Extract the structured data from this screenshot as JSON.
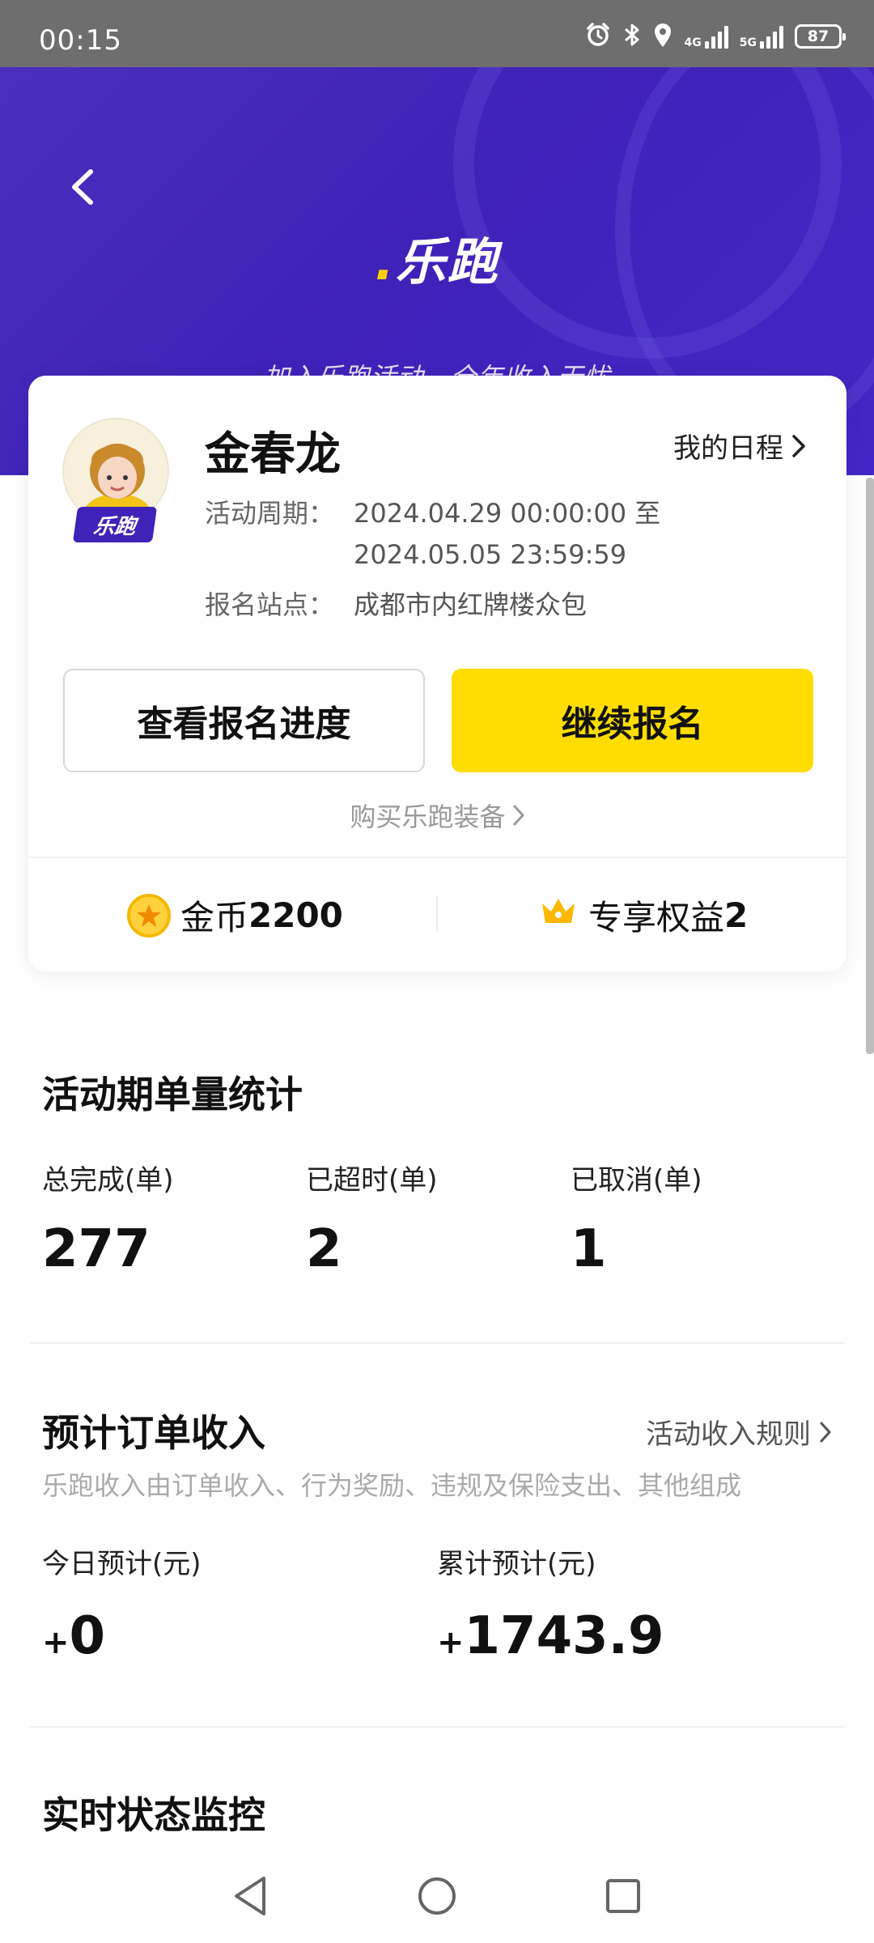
{
  "status_bar": {
    "time": "00:15",
    "network_1": "4G",
    "network_2": "5G",
    "battery": "87",
    "icons": [
      "alarm-icon",
      "bluetooth-icon",
      "location-icon",
      "signal-icon",
      "battery-icon"
    ]
  },
  "header": {
    "brand": "乐跑",
    "slogan": "加入乐跑活动，全年收入无忧"
  },
  "profile": {
    "name": "金春龙",
    "avatar_badge": "乐跑",
    "schedule_link": "我的日程",
    "period_label": "活动周期：",
    "period_line1": "2024.04.29 00:00:00 至",
    "period_line2": "2024.05.05 23:59:59",
    "station_label": "报名站点：",
    "station_value": "成都市内红牌楼众包",
    "btn_progress": "查看报名进度",
    "btn_continue": "继续报名",
    "buy_gear": "购买乐跑装备",
    "coins_label": "金币",
    "coins_value": "2200",
    "perks_label": "专享权益",
    "perks_value": "2"
  },
  "order_stats": {
    "title": "活动期单量统计",
    "items": [
      {
        "label": "总完成(单)",
        "value": "277"
      },
      {
        "label": "已超时(单)",
        "value": "2"
      },
      {
        "label": "已取消(单)",
        "value": "1"
      }
    ]
  },
  "income": {
    "title": "预计订单收入",
    "rules_link": "活动收入规则",
    "description": "乐跑收入由订单收入、行为奖励、违规及保险支出、其他组成",
    "today_label": "今日预计(元)",
    "today_sign": "+",
    "today_value": "0",
    "total_label": "累计预计(元)",
    "total_sign": "+",
    "total_value": "1743.9"
  },
  "monitor": {
    "title": "实时状态监控"
  },
  "colors": {
    "brand_purple": "#3f22b8",
    "accent_yellow": "#ffdd00"
  }
}
